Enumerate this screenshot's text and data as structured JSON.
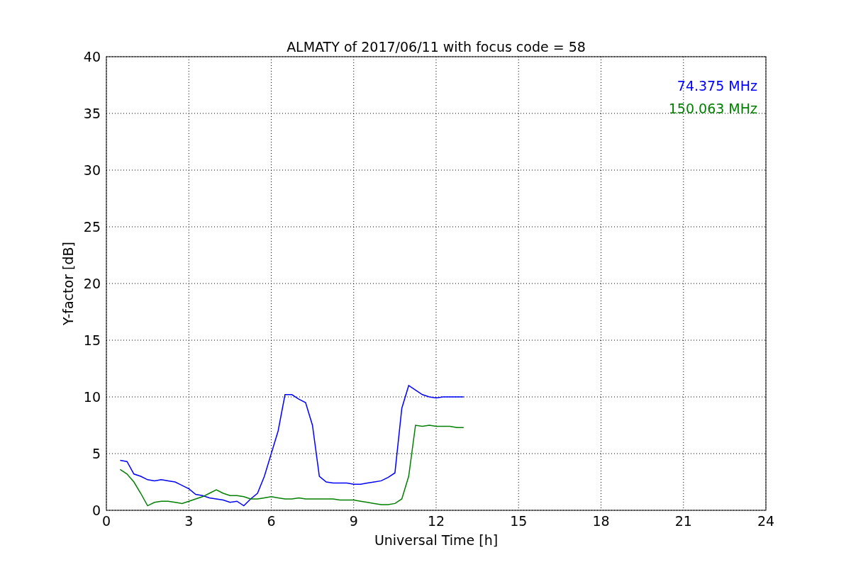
{
  "chart_data": {
    "type": "line",
    "title": "ALMATY of 2017/06/11 with focus code = 58",
    "xlabel": "Universal Time [h]",
    "ylabel": "Y-factor [dB]",
    "x": [
      0.5,
      0.75,
      1,
      1.25,
      1.5,
      1.75,
      2,
      2.25,
      2.5,
      2.75,
      3,
      3.25,
      3.5,
      3.75,
      4,
      4.25,
      4.5,
      4.75,
      5,
      5.25,
      5.5,
      5.75,
      6,
      6.25,
      6.5,
      6.75,
      7,
      7.25,
      7.5,
      7.75,
      8,
      8.25,
      8.5,
      8.75,
      9,
      9.25,
      9.5,
      9.75,
      10,
      10.25,
      10.5,
      10.75,
      11,
      11.25,
      11.5,
      11.75,
      12,
      12.25,
      12.5,
      12.75,
      13
    ],
    "series": [
      {
        "name": "74.375 MHz",
        "color": "#0000ff",
        "values": [
          4.4,
          4.3,
          3.2,
          3.0,
          2.7,
          2.6,
          2.7,
          2.6,
          2.5,
          2.2,
          1.9,
          1.4,
          1.3,
          1.1,
          1.0,
          0.9,
          0.7,
          0.8,
          0.4,
          1.0,
          1.5,
          3.0,
          5.0,
          7.0,
          10.2,
          10.2,
          9.8,
          9.5,
          7.5,
          3.0,
          2.5,
          2.4,
          2.4,
          2.4,
          2.3,
          2.3,
          2.4,
          2.5,
          2.6,
          2.9,
          3.3,
          9.0,
          11.0,
          10.6,
          10.2,
          10.0,
          9.9,
          10.0,
          10.0,
          10.0,
          10.0
        ]
      },
      {
        "name": "150.063 MHz",
        "color": "#008000",
        "values": [
          3.6,
          3.2,
          2.5,
          1.5,
          0.4,
          0.7,
          0.8,
          0.8,
          0.7,
          0.6,
          0.8,
          1.0,
          1.2,
          1.5,
          1.8,
          1.5,
          1.3,
          1.3,
          1.2,
          1.0,
          1.0,
          1.1,
          1.2,
          1.1,
          1.0,
          1.0,
          1.1,
          1.0,
          1.0,
          1.0,
          1.0,
          1.0,
          0.9,
          0.9,
          0.9,
          0.8,
          0.7,
          0.6,
          0.5,
          0.5,
          0.6,
          1.0,
          3.0,
          7.5,
          7.4,
          7.5,
          7.4,
          7.4,
          7.4,
          7.3,
          7.3
        ]
      }
    ],
    "grid": true,
    "xlim": [
      0,
      24
    ],
    "ylim": [
      0,
      40
    ],
    "xticks": [
      0,
      3,
      6,
      9,
      12,
      15,
      18,
      21,
      24
    ],
    "yticks": [
      0,
      5,
      10,
      15,
      20,
      25,
      30,
      35,
      40
    ]
  }
}
